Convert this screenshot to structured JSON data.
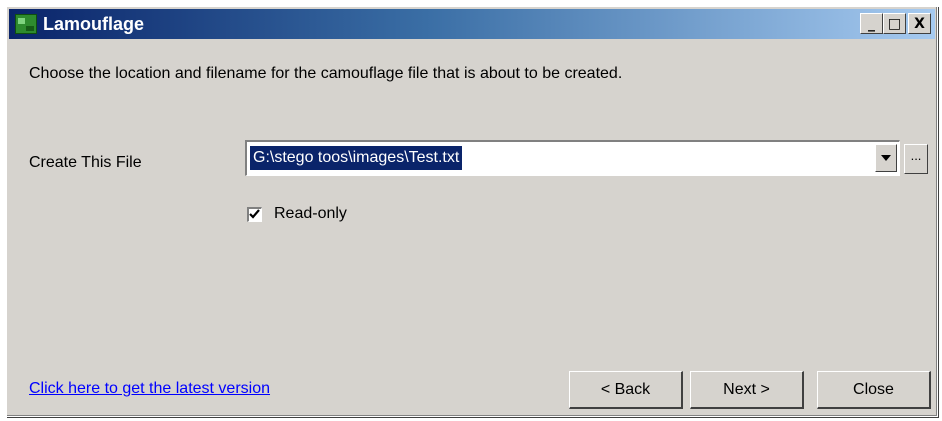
{
  "window": {
    "title": "Lamouflage",
    "icon": "app-icon",
    "controls": {
      "minimize": "_",
      "maximize": "□",
      "close": "X"
    }
  },
  "instructions": "Choose the location and filename for the camouflage file that is about to be created.",
  "file": {
    "label": "Create This File",
    "value": "G:\\stego toos\\images\\Test.txt",
    "browse_label": "..."
  },
  "readonly": {
    "label": "Read-only",
    "checked": true
  },
  "update_link": "Click here to get the latest version",
  "buttons": {
    "back": "< Back",
    "next": "Next >",
    "close": "Close"
  },
  "colors": {
    "face": "#d6d3ce",
    "titlebar": "#0a246a",
    "selection": "#0a246a",
    "link": "#0000ff"
  }
}
